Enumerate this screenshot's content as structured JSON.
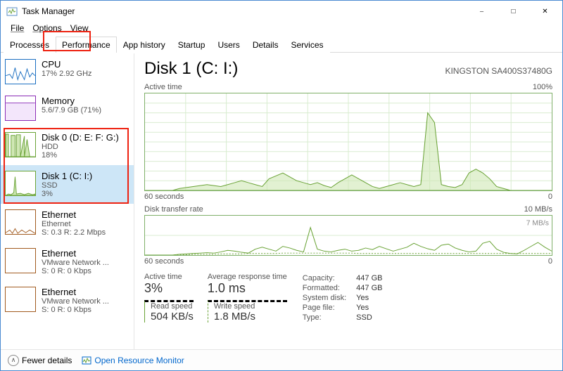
{
  "window": {
    "title": "Task Manager"
  },
  "menu": {
    "file": "File",
    "options": "Options",
    "view": "View"
  },
  "tabs": {
    "processes": "Processes",
    "performance": "Performance",
    "app_history": "App history",
    "startup": "Startup",
    "users": "Users",
    "details": "Details",
    "services": "Services"
  },
  "sidebar": {
    "items": [
      {
        "title": "CPU",
        "sub1": "17% 2.92 GHz",
        "sub2": ""
      },
      {
        "title": "Memory",
        "sub1": "5.6/7.9 GB (71%)",
        "sub2": ""
      },
      {
        "title": "Disk 0 (D: E: F: G:)",
        "sub1": "HDD",
        "sub2": "18%"
      },
      {
        "title": "Disk 1 (C: I:)",
        "sub1": "SSD",
        "sub2": "3%"
      },
      {
        "title": "Ethernet",
        "sub1": "Ethernet",
        "sub2": "S: 0.3 R: 2.2 Mbps"
      },
      {
        "title": "Ethernet",
        "sub1": "VMware Network ...",
        "sub2": "S: 0 R: 0 Kbps"
      },
      {
        "title": "Ethernet",
        "sub1": "VMware Network ...",
        "sub2": "S: 0 R: 0 Kbps"
      }
    ]
  },
  "main": {
    "title": "Disk 1 (C: I:)",
    "model": "KINGSTON SA400S37480G",
    "graph1": {
      "label": "Active time",
      "max": "100%",
      "xlabel_left": "60 seconds",
      "xlabel_right": "0"
    },
    "graph2": {
      "label": "Disk transfer rate",
      "max": "10 MB/s",
      "mark": "7 MB/s",
      "xlabel_left": "60 seconds",
      "xlabel_right": "0"
    },
    "stats": {
      "active_time": {
        "label": "Active time",
        "value": "3%"
      },
      "avg_resp": {
        "label": "Average response time",
        "value": "1.0 ms"
      },
      "read_speed": {
        "label": "Read speed",
        "value": "504 KB/s"
      },
      "write_speed": {
        "label": "Write speed",
        "value": "1.8 MB/s"
      }
    },
    "info": {
      "capacity": {
        "label": "Capacity:",
        "value": "447 GB"
      },
      "formatted": {
        "label": "Formatted:",
        "value": "447 GB"
      },
      "system": {
        "label": "System disk:",
        "value": "Yes"
      },
      "pagefile": {
        "label": "Page file:",
        "value": "Yes"
      },
      "type": {
        "label": "Type:",
        "value": "SSD"
      }
    }
  },
  "footer": {
    "fewer": "Fewer details",
    "orm": "Open Resource Monitor"
  },
  "chart_data": [
    {
      "type": "area",
      "title": "Active time",
      "ylabel": "%",
      "ylim": [
        0,
        100
      ],
      "xlabel": "seconds ago",
      "xlim": [
        60,
        0
      ],
      "values": [
        0,
        0,
        0,
        0,
        0,
        2,
        3,
        4,
        5,
        6,
        5,
        4,
        6,
        8,
        10,
        8,
        6,
        4,
        12,
        15,
        18,
        14,
        10,
        8,
        6,
        8,
        5,
        3,
        8,
        12,
        16,
        12,
        8,
        4,
        2,
        4,
        6,
        8,
        6,
        4,
        6,
        80,
        70,
        6,
        4,
        3,
        6,
        18,
        22,
        18,
        12,
        4,
        2,
        0,
        0,
        0,
        0,
        0,
        0,
        0
      ]
    },
    {
      "type": "line",
      "title": "Disk transfer rate",
      "ylabel": "MB/s",
      "ylim": [
        0,
        10
      ],
      "ymark": 7,
      "xlabel": "seconds ago",
      "xlim": [
        60,
        0
      ],
      "series": [
        {
          "name": "Read",
          "values": [
            0,
            0,
            0,
            0,
            0,
            0.2,
            0.3,
            0.4,
            0.5,
            0.6,
            0.5,
            0.8,
            1.2,
            1.0,
            0.7,
            0.5,
            1.5,
            2.0,
            1.5,
            1.0,
            2.2,
            1.8,
            1.2,
            0.8,
            7.0,
            1.5,
            1.0,
            0.8,
            1.2,
            1.5,
            1.0,
            1.2,
            1.8,
            1.4,
            2.2,
            1.6,
            1.0,
            1.5,
            2.0,
            3.0,
            2.2,
            1.6,
            1.2,
            2.5,
            2.8,
            1.8,
            1.2,
            0.8,
            1.0,
            3.0,
            3.5,
            1.5,
            0.7,
            0.4,
            0.3,
            1.2,
            2.2,
            3.2,
            2.0,
            1.0
          ]
        },
        {
          "name": "Write",
          "values": [
            0,
            0,
            0,
            0,
            0,
            0.1,
            0.1,
            0.2,
            0.2,
            0.2,
            0.2,
            0.3,
            0.3,
            0.3,
            0.3,
            0.4,
            0.4,
            0.4,
            0.4,
            0.4,
            0.5,
            0.5,
            0.5,
            0.5,
            0.5,
            0.5,
            0.5,
            0.5,
            0.5,
            0.5,
            0.5,
            0.4,
            0.4,
            0.4,
            0.4,
            0.4,
            0.4,
            0.4,
            0.4,
            0.4,
            0.4,
            0.4,
            0.4,
            0.4,
            0.4,
            0.4,
            0.4,
            0.4,
            0.4,
            0.4,
            0.4,
            0.4,
            0.4,
            0.4,
            0.4,
            0.4,
            0.4,
            0.4,
            0.4,
            0.4
          ]
        }
      ]
    }
  ]
}
